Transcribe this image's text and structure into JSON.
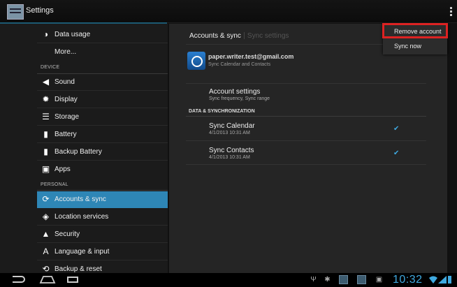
{
  "header": {
    "title": "Settings",
    "app_icon": "settings-app-icon",
    "overflow_icon": "overflow-menu-icon"
  },
  "sidebar": {
    "items": [
      {
        "label": "Data usage",
        "icon": "data-usage-icon"
      },
      {
        "label": "More...",
        "icon": ""
      },
      {
        "label": "Sound",
        "icon": "sound-icon"
      },
      {
        "label": "Display",
        "icon": "display-icon"
      },
      {
        "label": "Storage",
        "icon": "storage-icon"
      },
      {
        "label": "Battery",
        "icon": "battery-icon"
      },
      {
        "label": "Backup Battery",
        "icon": "backup-battery-icon"
      },
      {
        "label": "Apps",
        "icon": "apps-icon"
      },
      {
        "label": "Accounts & sync",
        "icon": "sync-icon",
        "active": true
      },
      {
        "label": "Location services",
        "icon": "location-icon"
      },
      {
        "label": "Security",
        "icon": "lock-icon"
      },
      {
        "label": "Language & input",
        "icon": "language-icon"
      },
      {
        "label": "Backup & reset",
        "icon": "backup-reset-icon"
      }
    ],
    "headers": {
      "device": "DEVICE",
      "personal": "PERSONAL"
    }
  },
  "detail": {
    "breadcrumb": {
      "current": "Accounts & sync",
      "next": "Sync settings"
    },
    "account": {
      "email": "paper.writer.test@gmail.com",
      "subtitle": "Sync Calendar and Contacts"
    },
    "account_settings": {
      "title": "Account settings",
      "subtitle": "Sync frequency, Sync range"
    },
    "section_header": "DATA & SYNCHRONIZATION",
    "sync_items": [
      {
        "title": "Sync Calendar",
        "date": "4/1/2013 10:31 AM",
        "checked": true
      },
      {
        "title": "Sync Contacts",
        "date": "4/1/2013 10:31 AM",
        "checked": true
      }
    ]
  },
  "menu": {
    "remove_account": "Remove account",
    "sync_now": "Sync now"
  },
  "statusbar": {
    "time": "10:32"
  },
  "colors": {
    "accent": "#3fa9e0",
    "active_item": "#2e86b6",
    "highlight_border": "#dd2222"
  }
}
